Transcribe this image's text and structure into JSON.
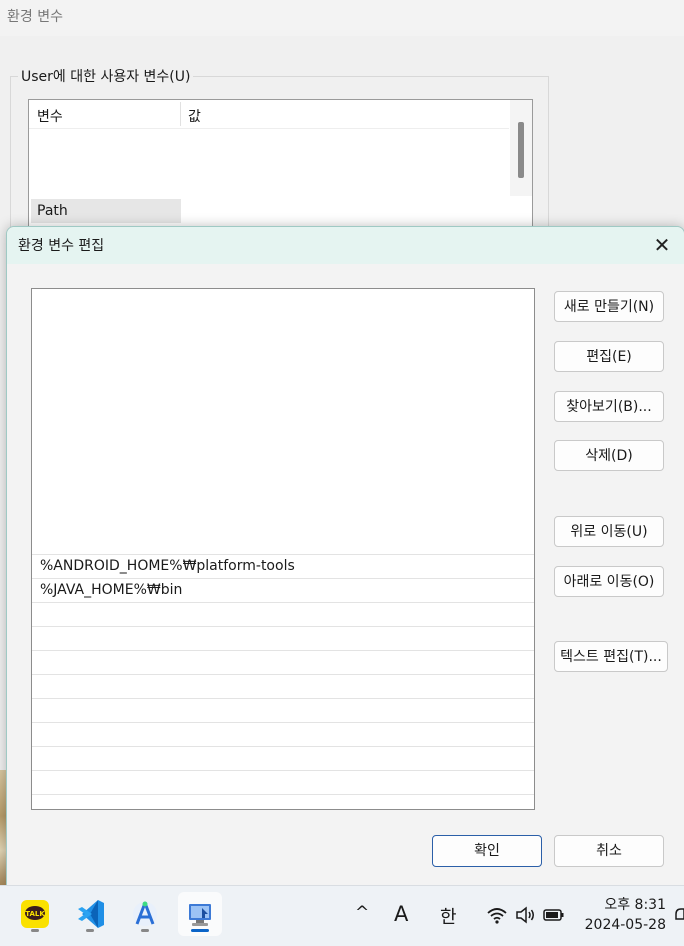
{
  "background_window": {
    "title": "환경 변수",
    "group_label": "User에 대한 사용자 변수(U)",
    "columns": [
      "변수",
      "값"
    ],
    "selected_row": "Path"
  },
  "dialog": {
    "title": "환경 변수 편집",
    "close_glyph": "✕",
    "entries": [
      "%ANDROID_HOME%₩platform-tools",
      "%JAVA_HOME%₩bin",
      "",
      "",
      "",
      "",
      "",
      "",
      "",
      "",
      ""
    ],
    "buttons": {
      "new": "새로 만들기(N)",
      "edit": "편집(E)",
      "browse": "찾아보기(B)...",
      "delete": "삭제(D)",
      "move_up": "위로 이동(U)",
      "move_down": "아래로 이동(O)",
      "edit_text": "텍스트 편집(T)...",
      "ok": "확인",
      "cancel": "취소"
    }
  },
  "taskbar": {
    "apps": [
      {
        "name": "kakaotalk-icon",
        "label": "TALK",
        "active": false
      },
      {
        "name": "vscode-icon",
        "active": false
      },
      {
        "name": "android-studio-icon",
        "active": false
      },
      {
        "name": "system-properties-icon",
        "active": true
      }
    ],
    "tray": {
      "chevron": "^",
      "input_mode": "A",
      "ime": "한"
    },
    "clock": {
      "time": "오후 8:31",
      "date": "2024-05-28"
    }
  },
  "colors": {
    "accent": "#0a64c8",
    "dialog_titlebar": "#e5f4f1",
    "primary_button_border": "#2b5fa8"
  }
}
